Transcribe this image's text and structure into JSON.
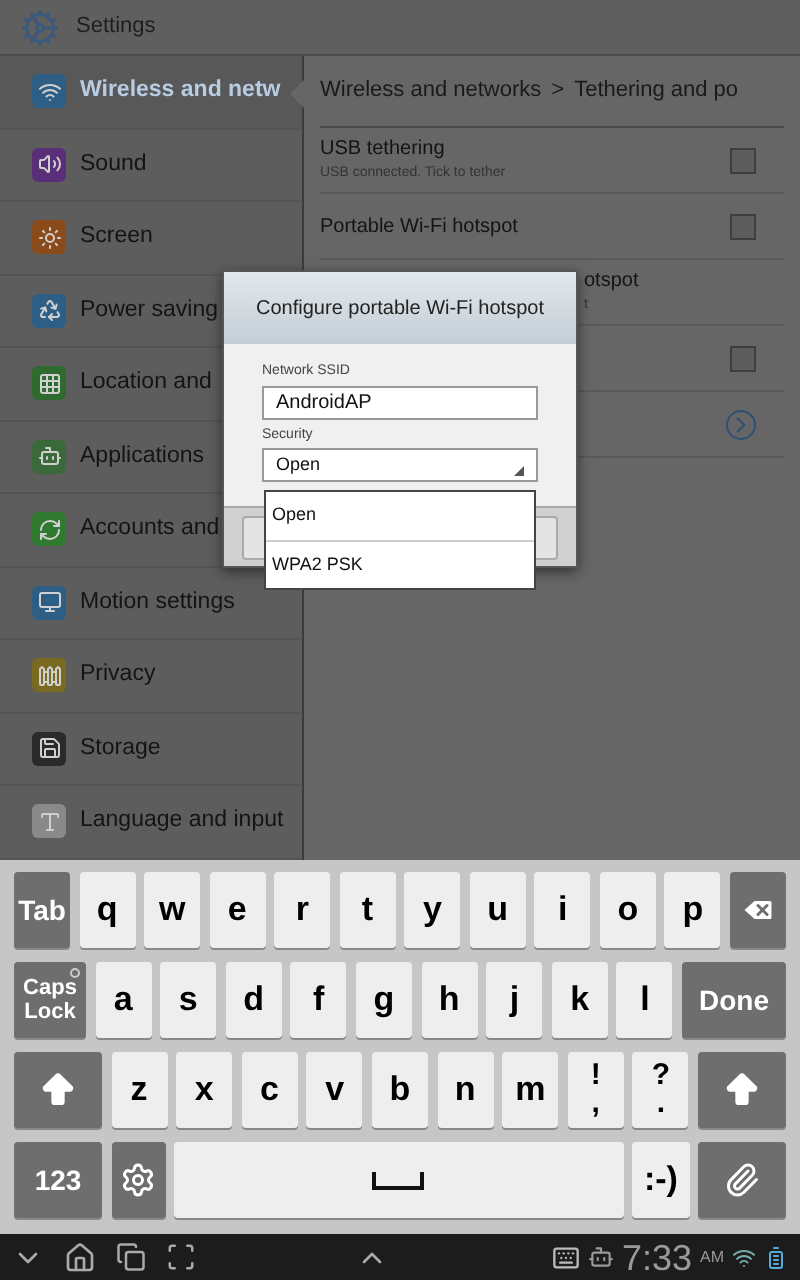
{
  "title_bar": {
    "title": "Settings"
  },
  "sidebar": {
    "items": [
      {
        "label": "Wireless and netw",
        "selected": true
      },
      {
        "label": "Sound",
        "selected": false
      },
      {
        "label": "Screen",
        "selected": false
      },
      {
        "label": "Power saving",
        "selected": false
      },
      {
        "label": "Location and",
        "selected": false
      },
      {
        "label": "Applications",
        "selected": false
      },
      {
        "label": "Accounts and",
        "selected": false
      },
      {
        "label": "Motion settings",
        "selected": false
      },
      {
        "label": "Privacy",
        "selected": false
      },
      {
        "label": "Storage",
        "selected": false
      },
      {
        "label": "Language and input",
        "selected": false
      }
    ]
  },
  "breadcrumb": {
    "parent": "Wireless and networks",
    "separator": ">",
    "current": "Tethering and po"
  },
  "settings_rows": [
    {
      "kind": "checkbox",
      "title": "USB tethering",
      "subtitle": "USB connected. Tick to tether",
      "checked": false
    },
    {
      "kind": "checkbox",
      "title": "Portable Wi-Fi hotspot",
      "checked": false
    },
    {
      "kind": "text",
      "title": "otspot",
      "subtitle": "t"
    },
    {
      "kind": "checkbox",
      "checked": false
    },
    {
      "kind": "link"
    }
  ],
  "dialog": {
    "title": "Configure portable Wi-Fi hotspot",
    "ssid_label": "Network SSID",
    "ssid_value": "AndroidAP",
    "security_label": "Security",
    "security_value": "Open",
    "dropdown_options": [
      "Open",
      "WPA2 PSK"
    ]
  },
  "keyboard": {
    "rows": [
      {
        "keys": [
          {
            "kind": "func",
            "label": "Tab"
          },
          {
            "kind": "char",
            "label": "q"
          },
          {
            "kind": "char",
            "label": "w"
          },
          {
            "kind": "char",
            "label": "e"
          },
          {
            "kind": "char",
            "label": "r"
          },
          {
            "kind": "char",
            "label": "t"
          },
          {
            "kind": "char",
            "label": "y"
          },
          {
            "kind": "char",
            "label": "u"
          },
          {
            "kind": "char",
            "label": "i"
          },
          {
            "kind": "char",
            "label": "o"
          },
          {
            "kind": "char",
            "label": "p"
          },
          {
            "kind": "backspace"
          }
        ]
      },
      {
        "keys": [
          {
            "kind": "caps",
            "label": "Caps Lock",
            "on": false
          },
          {
            "kind": "char",
            "label": "a"
          },
          {
            "kind": "char",
            "label": "s"
          },
          {
            "kind": "char",
            "label": "d"
          },
          {
            "kind": "char",
            "label": "f"
          },
          {
            "kind": "char",
            "label": "g"
          },
          {
            "kind": "char",
            "label": "h"
          },
          {
            "kind": "char",
            "label": "j"
          },
          {
            "kind": "char",
            "label": "k"
          },
          {
            "kind": "char",
            "label": "l"
          },
          {
            "kind": "done",
            "label": "Done"
          }
        ]
      },
      {
        "keys": [
          {
            "kind": "shift"
          },
          {
            "kind": "char",
            "label": "z"
          },
          {
            "kind": "char",
            "label": "x"
          },
          {
            "kind": "char",
            "label": "c"
          },
          {
            "kind": "char",
            "label": "v"
          },
          {
            "kind": "char",
            "label": "b"
          },
          {
            "kind": "char",
            "label": "n"
          },
          {
            "kind": "char",
            "label": "m"
          },
          {
            "kind": "dual",
            "top": "!",
            "bottom": ","
          },
          {
            "kind": "dual",
            "top": "?",
            "bottom": "."
          },
          {
            "kind": "shift"
          }
        ]
      },
      {
        "keys": [
          {
            "kind": "wide_func",
            "label": "123"
          },
          {
            "kind": "settings"
          },
          {
            "kind": "space"
          },
          {
            "kind": "char",
            "label": ":-)"
          },
          {
            "kind": "clip"
          }
        ]
      }
    ]
  },
  "status_bar": {
    "time": "7:33",
    "meridiem": "AM"
  }
}
